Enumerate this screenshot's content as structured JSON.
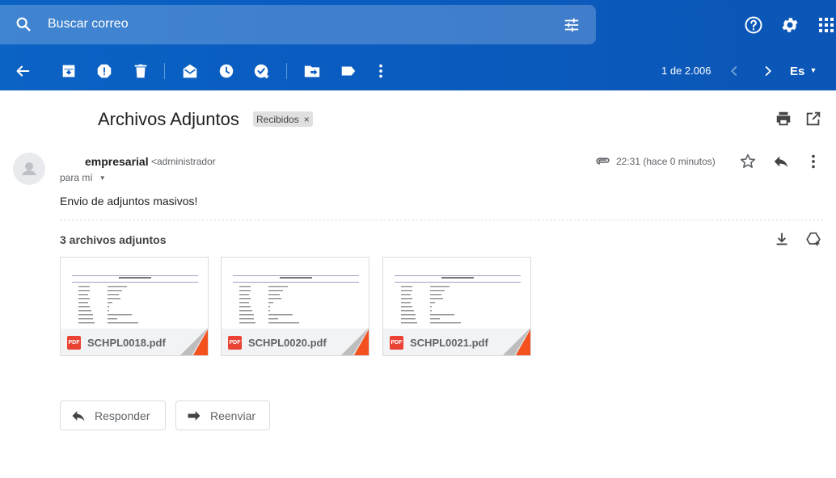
{
  "header": {
    "search_placeholder": "Buscar correo",
    "icons": [
      "search-icon",
      "tune-icon",
      "help-icon",
      "settings-icon",
      "apps-icon"
    ],
    "accent_color": "#0b5fc2"
  },
  "toolbar": {
    "icons": [
      "back-arrow-icon",
      "archive-icon",
      "report-spam-icon",
      "delete-icon",
      "mark-unread-icon",
      "snooze-icon",
      "add-task-icon",
      "move-to-icon",
      "label-icon",
      "more-vert-icon"
    ],
    "pager": "1 de 2.006",
    "language": "Es"
  },
  "message": {
    "subject": "Archivos Adjuntos",
    "label_chip": "Recibidos",
    "label_close": "×",
    "sender_name": "empresarial",
    "sender_email": "<administrador",
    "recipient": "para mí",
    "time": "22:31 (hace 0 minutos)",
    "body": "Envio de adjuntos masivos!"
  },
  "attachments": {
    "count_label": "3 archivos adjuntos",
    "badge": "PDF",
    "files": [
      {
        "name": "SCHPL0018.pdf"
      },
      {
        "name": "SCHPL0020.pdf"
      },
      {
        "name": "SCHPL0021.pdf"
      }
    ]
  },
  "actions": {
    "reply": "Responder",
    "forward": "Reenviar"
  }
}
